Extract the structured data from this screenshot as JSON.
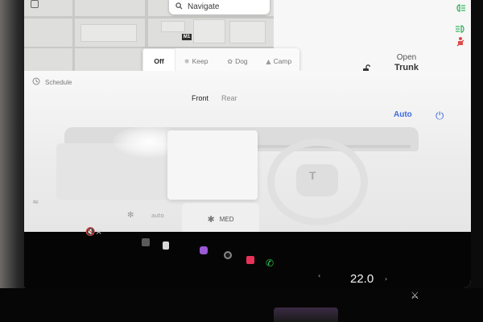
{
  "map": {
    "search_placeholder": "Navigate",
    "route_shield": "M1"
  },
  "status_icons": {
    "headlights": "headlight-icon",
    "auto_beam": "auto-highbeam-icon",
    "seatbelt": "seatbelt-warning-icon",
    "lock": "unlocked-icon"
  },
  "trunk": {
    "line1": "Open",
    "line2": "Trunk",
    "frunk_partial": "k"
  },
  "modes": [
    {
      "label": "Off",
      "icon": "",
      "selected": true
    },
    {
      "label": "Keep",
      "icon": "keep-climate-icon",
      "selected": false
    },
    {
      "label": "Dog",
      "icon": "dog-icon",
      "selected": false
    },
    {
      "label": "Camp",
      "icon": "camp-icon",
      "selected": false
    }
  ],
  "climate": {
    "schedule_label": "Schedule",
    "tab_front": "Front",
    "tab_rear": "Rear",
    "active_tab": "Front",
    "auto_label": "Auto",
    "fan_label": "MED"
  },
  "dock": {
    "volume": "mute-icon",
    "temperature": "22.0"
  },
  "colors": {
    "accent": "#3e6ae1",
    "screen_bg": "#f3f3f3",
    "dock_bg": "#050505",
    "headlight_green": "#2fb35a",
    "seatbelt_red": "#e24a4a"
  }
}
